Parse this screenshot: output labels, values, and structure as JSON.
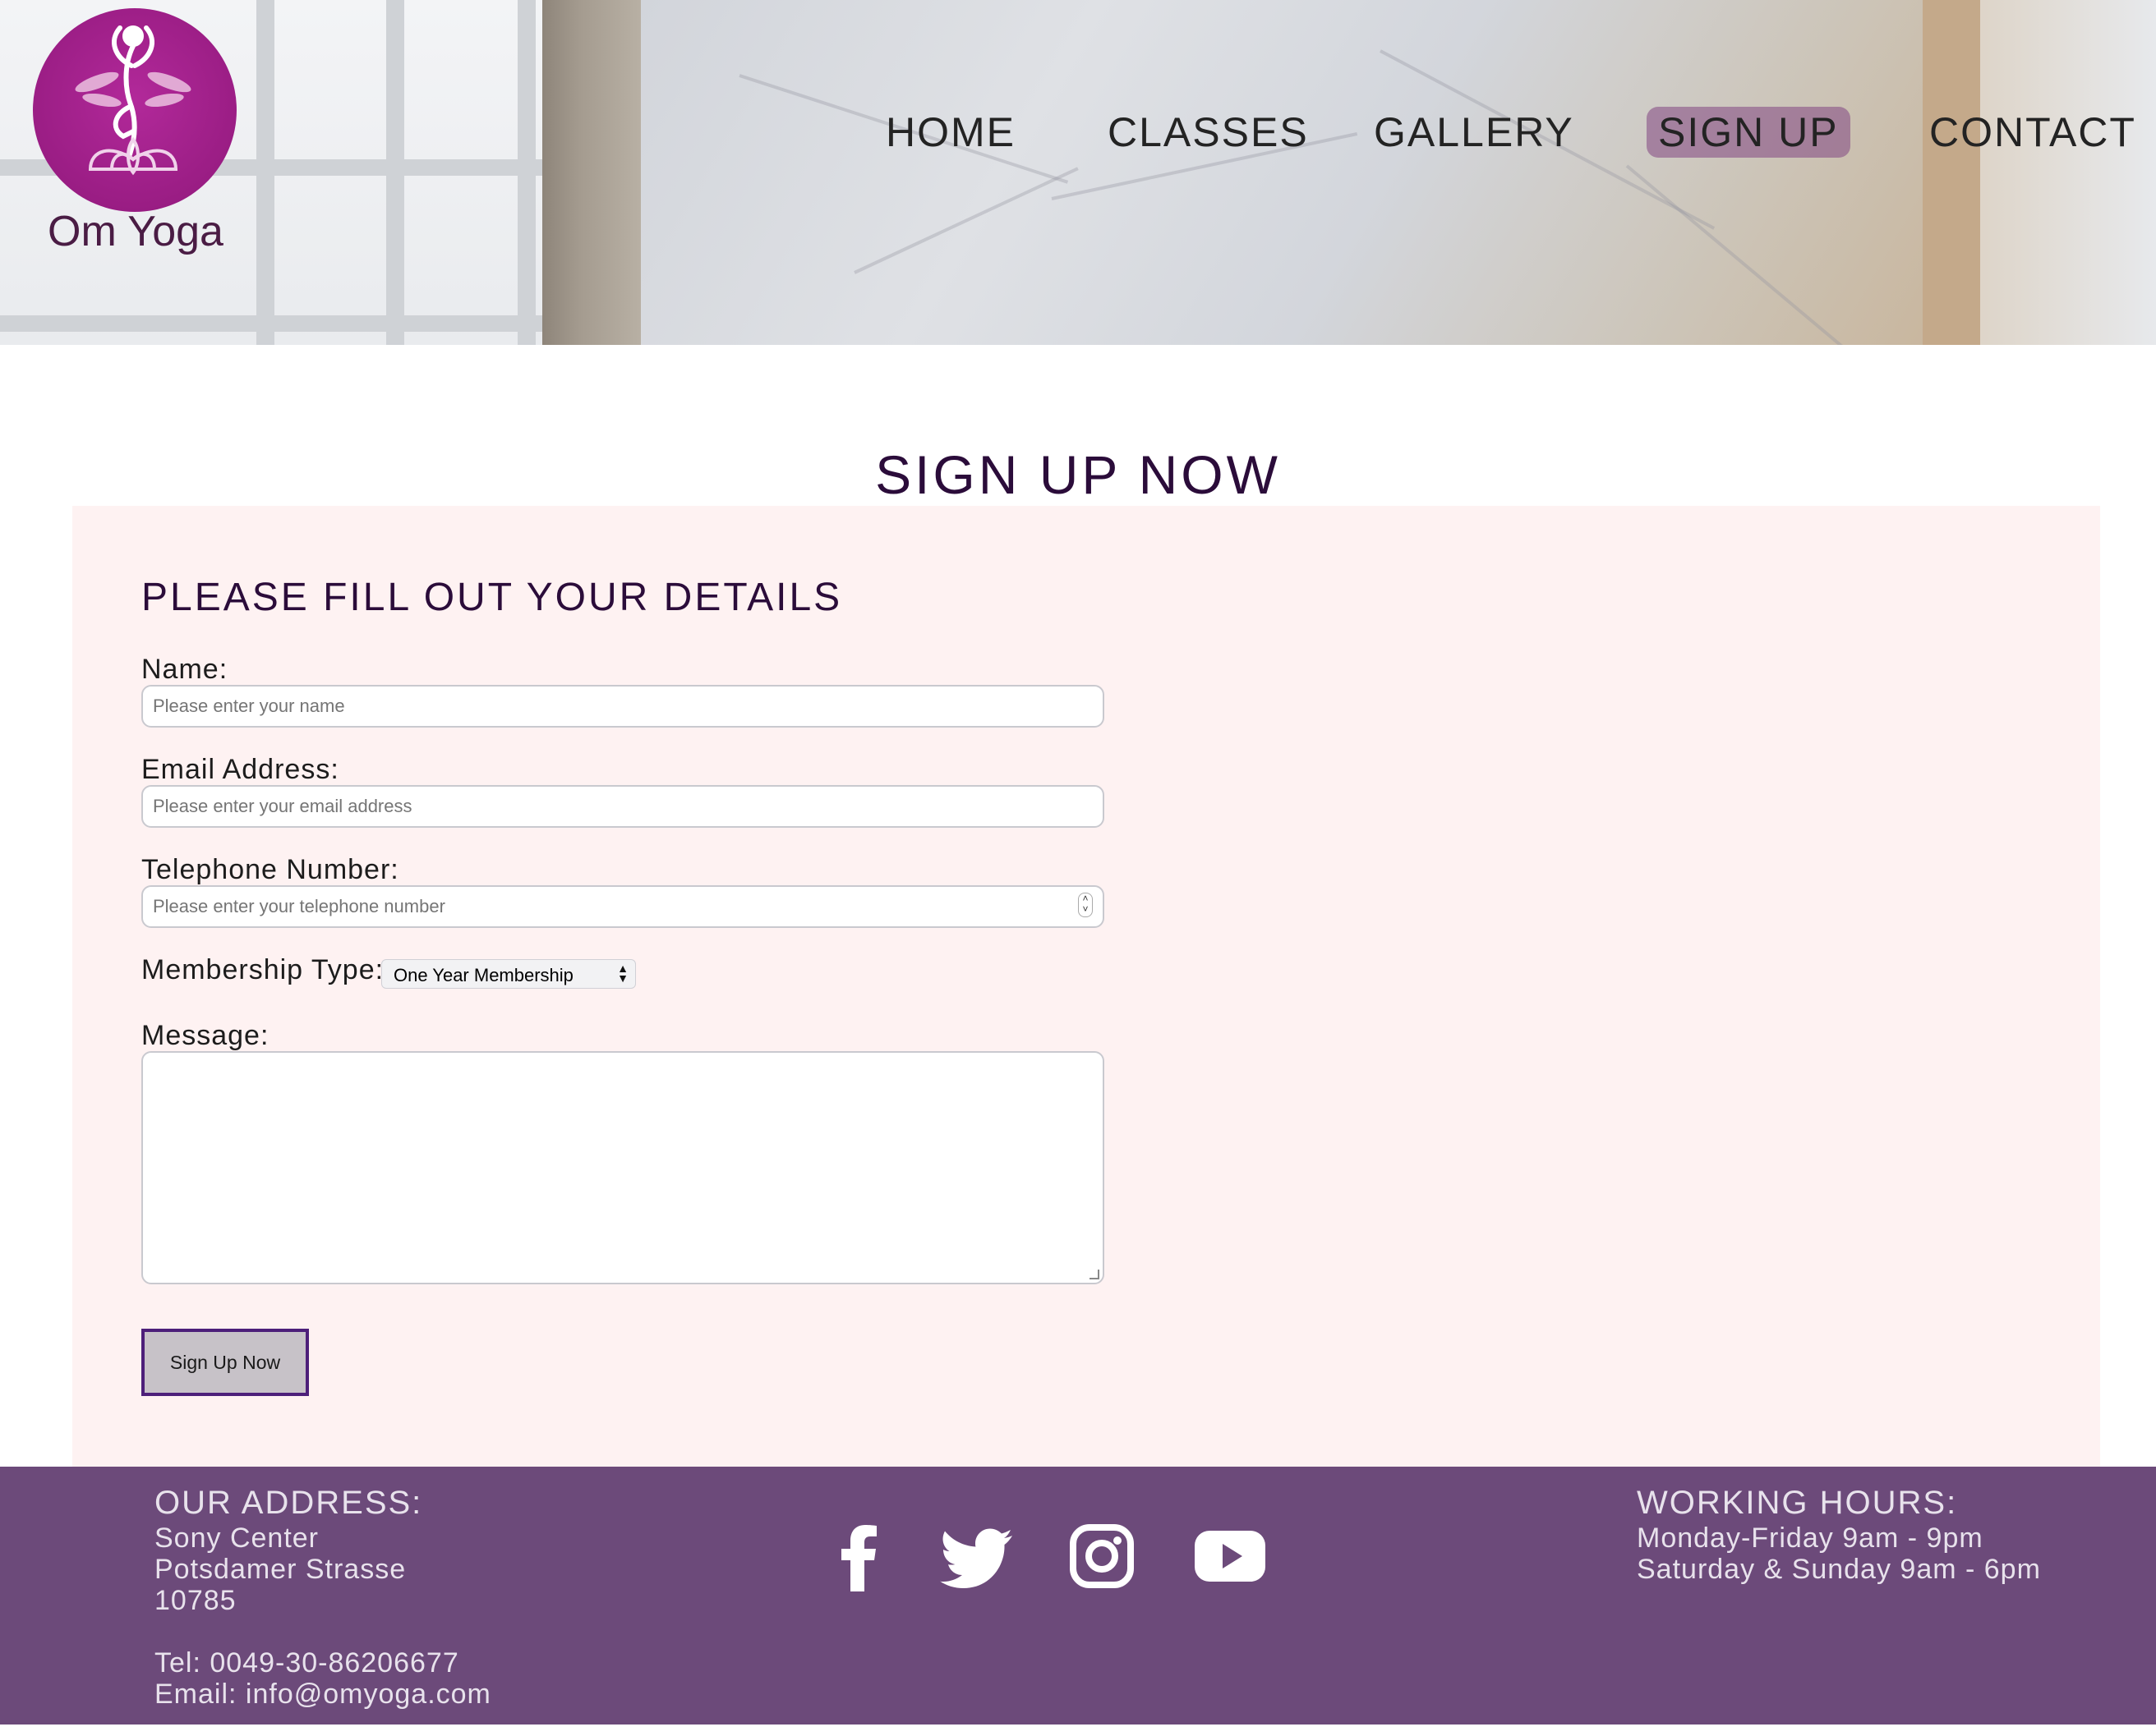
{
  "brand": {
    "name": "Om Yoga",
    "logo_color": "#9a1d84"
  },
  "nav": {
    "items": [
      {
        "label": "HOME",
        "active": false
      },
      {
        "label": "CLASSES",
        "active": false
      },
      {
        "label": "GALLERY",
        "active": false
      },
      {
        "label": "SIGN UP",
        "active": true
      },
      {
        "label": "CONTACT",
        "active": false
      }
    ]
  },
  "page": {
    "title": "SIGN UP NOW"
  },
  "form": {
    "heading": "PLEASE FILL OUT YOUR DETAILS",
    "name": {
      "label": "Name:",
      "placeholder": "Please enter your name",
      "value": ""
    },
    "email": {
      "label": "Email Address:",
      "placeholder": "Please enter your email address",
      "value": ""
    },
    "phone": {
      "label": "Telephone Number:",
      "placeholder": "Please enter your telephone number",
      "value": ""
    },
    "membership": {
      "label": "Membership Type:",
      "selected": "One Year Membership"
    },
    "message": {
      "label": "Message:",
      "value": ""
    },
    "submit_label": "Sign Up Now"
  },
  "footer": {
    "address": {
      "heading": "OUR ADDRESS:",
      "lines": [
        "Sony Center",
        "Potsdamer Strasse",
        "10785"
      ],
      "tel": "Tel: 0049-30-86206677",
      "email": "Email: info@omyoga.com"
    },
    "social": [
      "facebook-icon",
      "twitter-icon",
      "instagram-icon",
      "youtube-icon"
    ],
    "hours": {
      "heading": "WORKING HOURS:",
      "lines": [
        "Monday-Friday 9am - 9pm",
        "Saturday & Sunday 9am - 6pm"
      ]
    }
  },
  "colors": {
    "accent": "#2b0c3a",
    "footer_bg": "#6c4a7a",
    "panel_bg": "#fef2f2",
    "nav_active": "#82468c"
  }
}
